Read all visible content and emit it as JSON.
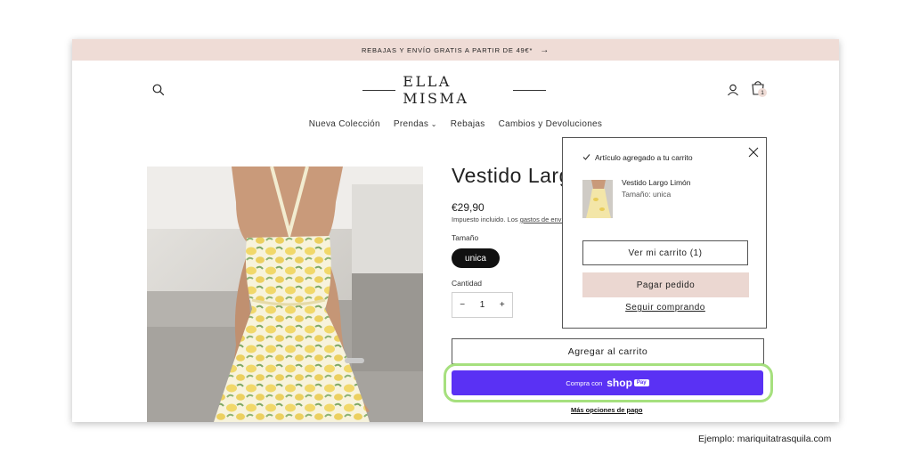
{
  "announcement": {
    "text": "REBAJAS Y ENVÍO GRATIS A PARTIR DE 49€*",
    "arrow": "→"
  },
  "header": {
    "logo": "ELLA MISMA",
    "cart_count": "1",
    "icons": [
      "search-icon",
      "account-icon",
      "cart-icon"
    ]
  },
  "nav": {
    "items": [
      {
        "label": "Nueva Colección"
      },
      {
        "label": "Prendas"
      },
      {
        "label": "Rebajas"
      },
      {
        "label": "Cambios y Devoluciones"
      }
    ]
  },
  "product": {
    "title": "Vestido Largo Limón",
    "price": "€29,90",
    "tax_text": "Impuesto incluido. Los ",
    "tax_link": "gastos de envío",
    "size_label": "Tamaño",
    "size_value": "unica",
    "quantity_label": "Cantidad",
    "quantity": "1",
    "minus": "−",
    "plus": "+",
    "add_to_cart": "Agregar al carrito",
    "shoppay_prefix": "Compra con",
    "shoppay_brand": "shop",
    "shoppay_pay": "Pay",
    "more_options": "Más opciones de pago"
  },
  "cart_popup": {
    "added_text": "Artículo agregado a tu carrito",
    "item_name": "Vestido Largo Limón",
    "item_size": "Tamaño: unica",
    "view_cart": "Ver mi carrito (1)",
    "checkout": "Pagar pedido",
    "keep_shopping": "Seguir comprando"
  },
  "credit": "Ejemplo: mariquitatrasquila.com",
  "colors": {
    "announce_bg": "#efdcd6",
    "checkout_bg": "#ebd7d1",
    "shoppay": "#5a31f4",
    "highlight": "#a6e07e"
  }
}
